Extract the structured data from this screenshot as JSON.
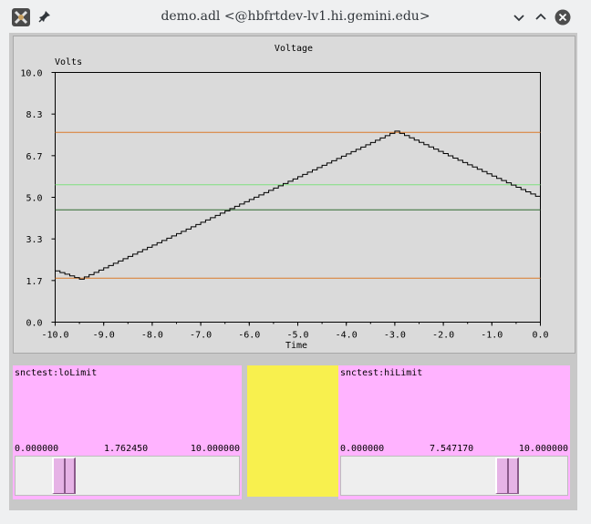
{
  "window": {
    "title": "demo.adl  <@hbfrtdev-lv1.hi.gemini.edu>",
    "controls": [
      "minimize",
      "maximize",
      "close"
    ]
  },
  "chart_data": {
    "type": "line",
    "title": "Voltage",
    "ylabel": "Volts",
    "xlabel": "Time",
    "xlim": [
      -10.0,
      0.0
    ],
    "ylim": [
      0.0,
      10.0
    ],
    "x_ticks": [
      "-10.0",
      "-9.0",
      "-8.0",
      "-7.0",
      "-6.0",
      "-5.0",
      "-4.0",
      "-3.0",
      "-2.0",
      "-1.0",
      "0.0"
    ],
    "y_ticks": [
      "0.0",
      "1.7",
      "3.3",
      "5.0",
      "6.7",
      "8.3",
      "10.0"
    ],
    "grid": false,
    "series": [
      {
        "color": "#000000",
        "style": "step",
        "points": [
          [
            -10.0,
            2.05
          ],
          [
            -9.5,
            1.72
          ],
          [
            -3.0,
            7.65
          ],
          [
            0.0,
            4.95
          ]
        ]
      }
    ],
    "reference_lines": [
      {
        "y": 7.6,
        "color": "#d97a2b"
      },
      {
        "y": 5.5,
        "color": "#7fe07f"
      },
      {
        "y": 4.5,
        "color": "#2f6b2f"
      },
      {
        "y": 1.76,
        "color": "#d97a2b"
      }
    ]
  },
  "sliders": [
    {
      "name": "snctest:loLimit",
      "min": "0.000000",
      "value": "1.762450",
      "max": "10.000000",
      "fraction": 0.17625
    },
    {
      "name": "snctest:hiLimit",
      "min": "0.000000",
      "value": "7.547170",
      "max": "10.000000",
      "fraction": 0.75472
    }
  ],
  "colors": {
    "slider_bg": "#ffb3ff",
    "indicator": "#f8f04e",
    "panel": "#dadada"
  }
}
